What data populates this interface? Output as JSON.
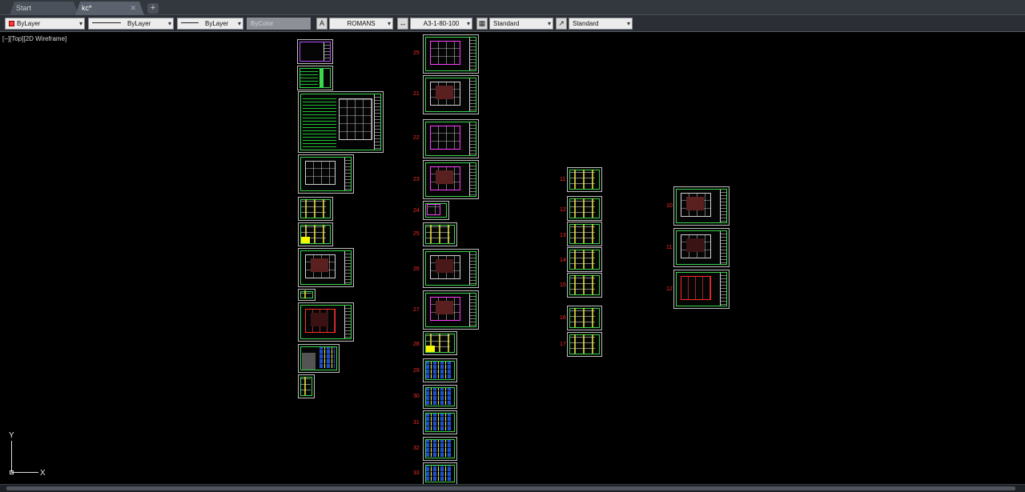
{
  "tabs": {
    "start": "Start",
    "active": "kc*",
    "close_glyph": "✕",
    "add_glyph": "+"
  },
  "toolbar": {
    "color": "ByLayer",
    "linetype": "ByLayer",
    "lineweight": "ByLayer",
    "plotstyle": "ByColor",
    "text_style": "ROMANS",
    "dim_style": "A3-1-80-100",
    "table_style": "Standard",
    "multileader_style": "Standard"
  },
  "icons": {
    "text_style": "text-style-icon",
    "dim_style": "dimension-style-icon",
    "table_style": "table-style-icon",
    "mleader_style": "multileader-style-icon",
    "dropdown": "chevron-down-icon"
  },
  "colors": {
    "frame_green": "#37d24a",
    "number_red": "#ff2b2b",
    "background": "#000000"
  },
  "viewport": {
    "label": "[−][Top][2D Wireframe]"
  },
  "ucs": {
    "x_label": "X",
    "y_label": "Y"
  },
  "sheet_numbers": {
    "c1": [
      "",
      "",
      "",
      "",
      "",
      "",
      "",
      "",
      "",
      ""
    ],
    "c2": [
      "25",
      "21",
      "22",
      "23",
      "24",
      "25",
      "26",
      "27",
      "28",
      "29",
      "30",
      "31",
      "32",
      "33"
    ],
    "c3": [
      "11",
      "12",
      "13",
      "14",
      "15",
      "16",
      "17",
      "18"
    ],
    "c4": [
      "10",
      "11",
      "12"
    ]
  }
}
